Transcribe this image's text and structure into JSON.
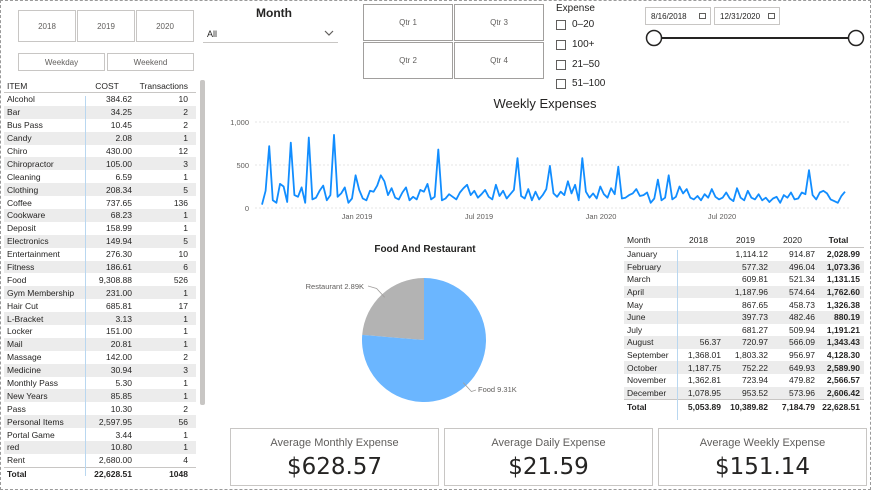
{
  "year_slicer": [
    "2018",
    "2019",
    "2020"
  ],
  "day_slicer": [
    "Weekday",
    "Weekend"
  ],
  "month_slicer": {
    "title": "Month",
    "value": "All"
  },
  "quarter_slicer": [
    "Qtr 1",
    "Qtr 3",
    "Qtr 2",
    "Qtr 4"
  ],
  "expense_slicer": {
    "title": "Expense",
    "options": [
      "0–20",
      "100+",
      "21–50",
      "51–100"
    ]
  },
  "date_range": {
    "start": "8/16/2018",
    "end": "12/31/2020"
  },
  "item_table": {
    "headers": [
      "ITEM",
      "COST",
      "Transactions"
    ],
    "rows": [
      [
        "Alcohol",
        "384.62",
        "10"
      ],
      [
        "Bar",
        "34.25",
        "2"
      ],
      [
        "Bus Pass",
        "10.45",
        "2"
      ],
      [
        "Candy",
        "2.08",
        "1"
      ],
      [
        "Chiro",
        "430.00",
        "12"
      ],
      [
        "Chiropractor",
        "105.00",
        "3"
      ],
      [
        "Cleaning",
        "6.59",
        "1"
      ],
      [
        "Clothing",
        "208.34",
        "5"
      ],
      [
        "Coffee",
        "737.65",
        "136"
      ],
      [
        "Cookware",
        "68.23",
        "1"
      ],
      [
        "Deposit",
        "158.99",
        "1"
      ],
      [
        "Electronics",
        "149.94",
        "5"
      ],
      [
        "Entertainment",
        "276.30",
        "10"
      ],
      [
        "Fitness",
        "186.61",
        "6"
      ],
      [
        "Food",
        "9,308.88",
        "526"
      ],
      [
        "Gym Membership",
        "231.00",
        "1"
      ],
      [
        "Hair Cut",
        "685.81",
        "17"
      ],
      [
        "L-Bracket",
        "3.13",
        "1"
      ],
      [
        "Locker",
        "151.00",
        "1"
      ],
      [
        "Mail",
        "20.81",
        "1"
      ],
      [
        "Massage",
        "142.00",
        "2"
      ],
      [
        "Medicine",
        "30.94",
        "3"
      ],
      [
        "Monthly Pass",
        "5.30",
        "1"
      ],
      [
        "New Years",
        "85.85",
        "1"
      ],
      [
        "Pass",
        "10.30",
        "2"
      ],
      [
        "Personal Items",
        "2,597.95",
        "56"
      ],
      [
        "Portal Game",
        "3.44",
        "1"
      ],
      [
        "red",
        "10.80",
        "1"
      ],
      [
        "Rent",
        "2,680.00",
        "4"
      ]
    ],
    "total": [
      "Total",
      "22,628.51",
      "1048"
    ]
  },
  "weekly_chart": {
    "title": "Weekly Expenses",
    "y_ticks": [
      "1,000",
      "500",
      "0"
    ],
    "x_ticks": [
      "Jan 2019",
      "Jul 2019",
      "Jan 2020",
      "Jul 2020"
    ],
    "line_color": "#118DFF"
  },
  "chart_data": [
    {
      "type": "line",
      "title": "Weekly Expenses",
      "xlabel": "",
      "ylabel": "",
      "x_range": [
        "2018-08-16",
        "2020-12-31"
      ],
      "ylim": [
        0,
        1000
      ],
      "series": [
        {
          "values": [
            40,
            200,
            720,
            90,
            60,
            280,
            250,
            70,
            760,
            150,
            130,
            240,
            60,
            820,
            100,
            120,
            200,
            260,
            90,
            150,
            850,
            130,
            170,
            240,
            60,
            110,
            380,
            210,
            110,
            90,
            200,
            190,
            260,
            380,
            310,
            150,
            230,
            120,
            100,
            180,
            240,
            90,
            130,
            100,
            210,
            190,
            280,
            100,
            130,
            680,
            90,
            110,
            160,
            130,
            100,
            180,
            230,
            270,
            150,
            200,
            120,
            160,
            210,
            130,
            100,
            270,
            140,
            200,
            110,
            160,
            210,
            580,
            140,
            110,
            220,
            90,
            190,
            100,
            150,
            220,
            490,
            170,
            130,
            190,
            150,
            310,
            170,
            270,
            90,
            580,
            190,
            120,
            170,
            110,
            250,
            160,
            120,
            230,
            160,
            480,
            110,
            120,
            150,
            170,
            220,
            140,
            150,
            180,
            60,
            110,
            330,
            90,
            120,
            380,
            100,
            130,
            250,
            170,
            220,
            120,
            100,
            140,
            90,
            160,
            120,
            220,
            130,
            100,
            120,
            180,
            110,
            80,
            230,
            120,
            90,
            200,
            120,
            100,
            160,
            90,
            120,
            70,
            110,
            130,
            60,
            150,
            120,
            180,
            100,
            110,
            180,
            160,
            440,
            150,
            100,
            180,
            200,
            170,
            100,
            80,
            60,
            140,
            190
          ]
        }
      ]
    },
    {
      "type": "pie",
      "title": "Food And Restaurant",
      "categories": [
        "Restaurant",
        "Food"
      ],
      "values": [
        2890,
        9310
      ],
      "labels": [
        "Restaurant 2.89K",
        "Food 9.31K"
      ],
      "colors": [
        "#B3B3B3",
        "#6BB6FF"
      ]
    }
  ],
  "month_table": {
    "headers": [
      "Month",
      "2018",
      "2019",
      "2020",
      "Total"
    ],
    "rows": [
      [
        "January",
        "",
        "1,114.12",
        "914.87",
        "2,028.99"
      ],
      [
        "February",
        "",
        "577.32",
        "496.04",
        "1,073.36"
      ],
      [
        "March",
        "",
        "609.81",
        "521.34",
        "1,131.15"
      ],
      [
        "April",
        "",
        "1,187.96",
        "574.64",
        "1,762.60"
      ],
      [
        "May",
        "",
        "867.65",
        "458.73",
        "1,326.38"
      ],
      [
        "June",
        "",
        "397.73",
        "482.46",
        "880.19"
      ],
      [
        "July",
        "",
        "681.27",
        "509.94",
        "1,191.21"
      ],
      [
        "August",
        "56.37",
        "720.97",
        "566.09",
        "1,343.43"
      ],
      [
        "September",
        "1,368.01",
        "1,803.32",
        "956.97",
        "4,128.30"
      ],
      [
        "October",
        "1,187.75",
        "752.22",
        "649.93",
        "2,589.90"
      ],
      [
        "November",
        "1,362.81",
        "723.94",
        "479.82",
        "2,566.57"
      ],
      [
        "December",
        "1,078.95",
        "953.52",
        "573.96",
        "2,606.42"
      ]
    ],
    "total": [
      "Total",
      "5,053.89",
      "10,389.82",
      "7,184.79",
      "22,628.51"
    ]
  },
  "kpis": [
    {
      "label": "Average Monthly Expense",
      "value": "$628.57"
    },
    {
      "label": "Average Daily Expense",
      "value": "$21.59"
    },
    {
      "label": "Average Weekly Expense",
      "value": "$151.14"
    }
  ]
}
